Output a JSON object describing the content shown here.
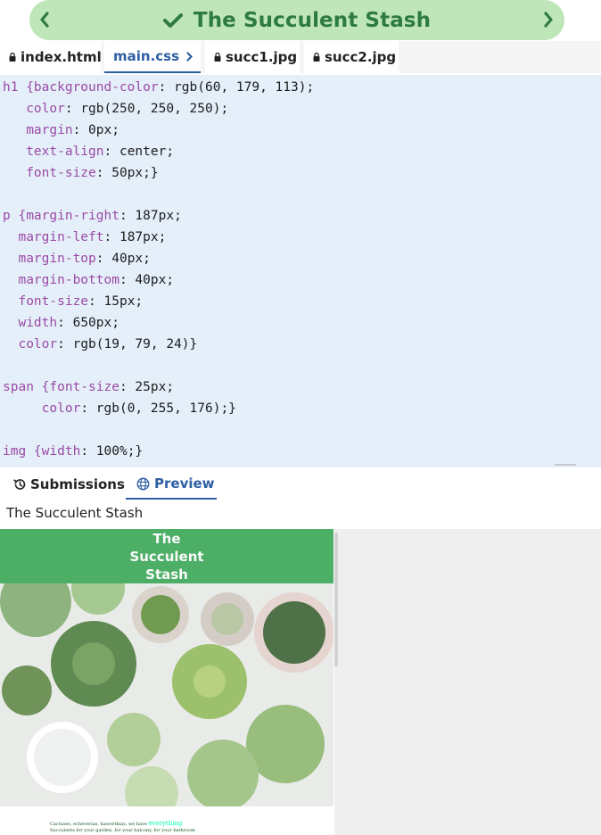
{
  "lesson": {
    "title": "The Succulent Stash",
    "prev_icon": "chevron-left-icon",
    "next_icon": "chevron-right-icon",
    "status_icon": "check-icon",
    "accent": "#2e7a43",
    "pill_bg": "#bfe6b8"
  },
  "file_tabs": [
    {
      "label": "index.html",
      "icon": "lock-icon",
      "active": false
    },
    {
      "label": "main.css",
      "icon": "chevron-right-icon",
      "active": true
    },
    {
      "label": "succ1.jpg",
      "icon": "lock-icon",
      "active": false
    },
    {
      "label": "succ2.jpg",
      "icon": "lock-icon",
      "active": false
    }
  ],
  "code": {
    "lines": [
      {
        "sel": "h1 {",
        "prop": "background-color",
        "rest": ": rgb(60, 179, 113);",
        "indent": ""
      },
      {
        "sel": "",
        "prop": "color",
        "rest": ": rgb(250, 250, 250);",
        "indent": "   "
      },
      {
        "sel": "",
        "prop": "margin",
        "rest": ": 0px;",
        "indent": "   "
      },
      {
        "sel": "",
        "prop": "text-align",
        "rest": ": center;",
        "indent": "   "
      },
      {
        "sel": "",
        "prop": "font-size",
        "rest": ": 50px;}",
        "indent": "   "
      },
      {
        "sel": "",
        "prop": "",
        "rest": "",
        "indent": ""
      },
      {
        "sel": "p {",
        "prop": "margin-right",
        "rest": ": 187px;",
        "indent": ""
      },
      {
        "sel": "",
        "prop": "margin-left",
        "rest": ": 187px;",
        "indent": "  "
      },
      {
        "sel": "",
        "prop": "margin-top",
        "rest": ": 40px;",
        "indent": "  "
      },
      {
        "sel": "",
        "prop": "margin-bottom",
        "rest": ": 40px;",
        "indent": "  "
      },
      {
        "sel": "",
        "prop": "font-size",
        "rest": ": 15px;",
        "indent": "  "
      },
      {
        "sel": "",
        "prop": "width",
        "rest": ": 650px;",
        "indent": "  "
      },
      {
        "sel": "",
        "prop": "color",
        "rest": ": rgb(19, 79, 24)}",
        "indent": "  "
      },
      {
        "sel": "",
        "prop": "",
        "rest": "",
        "indent": ""
      },
      {
        "sel": "span {",
        "prop": "font-size",
        "rest": ": 25px;",
        "indent": ""
      },
      {
        "sel": "",
        "prop": "color",
        "rest": ": rgb(0, 255, 176);}",
        "indent": "     "
      },
      {
        "sel": "",
        "prop": "",
        "rest": "",
        "indent": ""
      },
      {
        "sel": "img {",
        "prop": "width",
        "rest": ": 100%;}",
        "indent": ""
      }
    ],
    "bg": "#e4effa",
    "property_color": "#9b4aa5"
  },
  "lower_tabs": [
    {
      "label": "Submissions",
      "icon": "history-icon",
      "active": false
    },
    {
      "label": "Preview",
      "icon": "globe-icon",
      "active": true
    }
  ],
  "preview": {
    "page_title": "The Succulent Stash",
    "heading_lines": [
      "The",
      "Succulent",
      "Stash"
    ],
    "heading_bg": "#4dae66",
    "caption_text": "Cactuses, echeverias, haworthias, we have",
    "caption_highlight": "everything",
    "caption_line2": "Succulents for your garden, for your balcony, for your bathroom"
  }
}
